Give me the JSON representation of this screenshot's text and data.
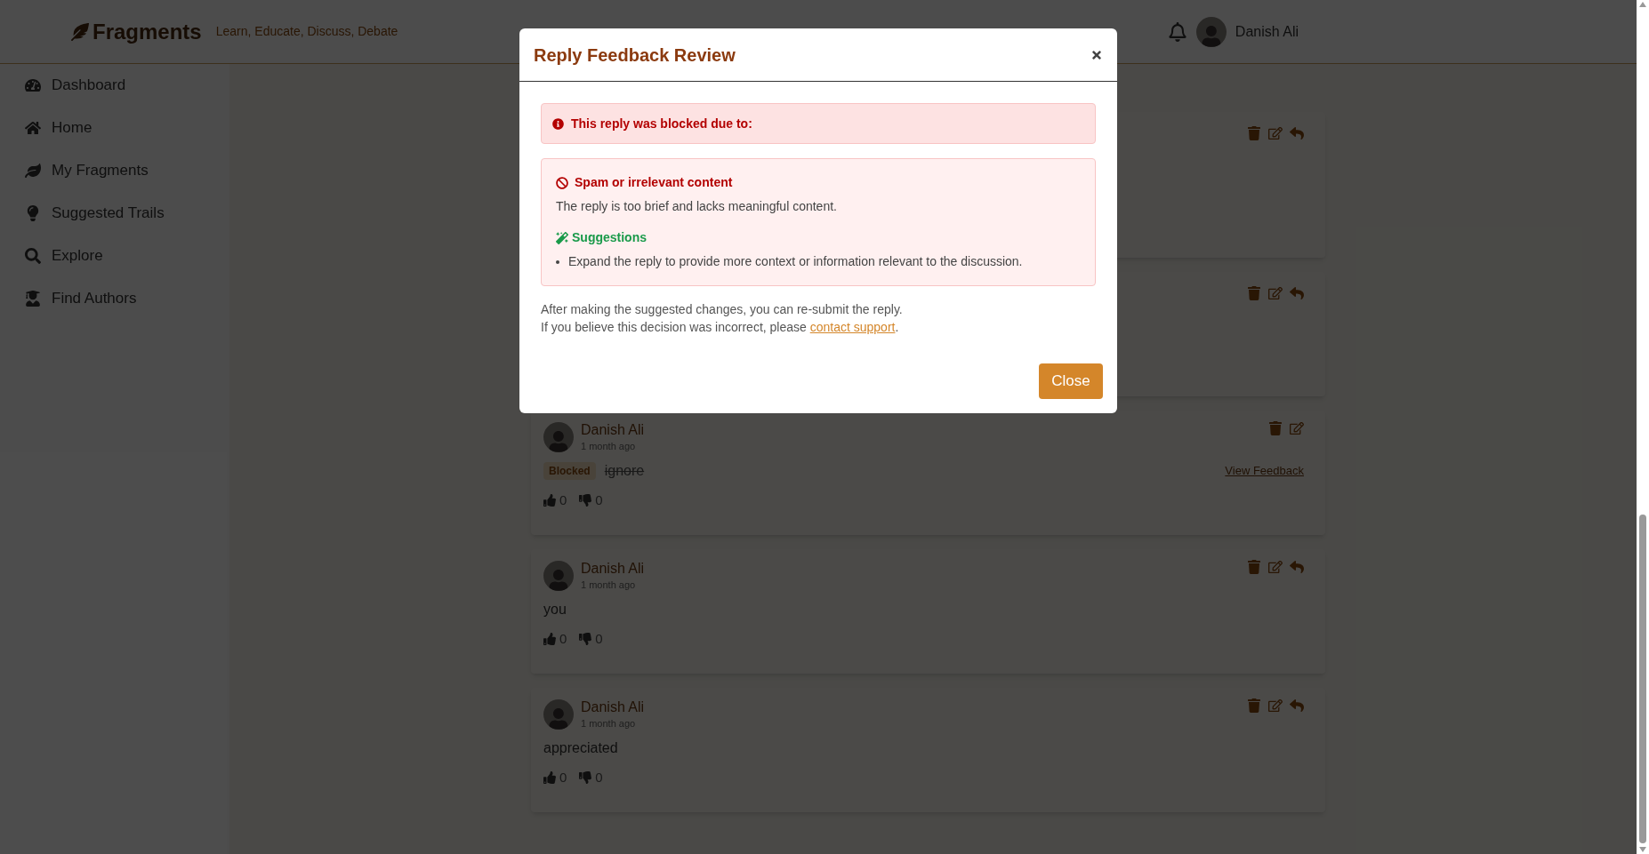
{
  "header": {
    "logo": "Fragments",
    "tagline": "Learn, Educate, Discuss, Debate",
    "user_name": "Danish Ali"
  },
  "sidebar": {
    "items": [
      {
        "label": "Dashboard"
      },
      {
        "label": "Home"
      },
      {
        "label": "My Fragments"
      },
      {
        "label": "Suggested Trails"
      },
      {
        "label": "Explore"
      },
      {
        "label": "Find Authors"
      }
    ]
  },
  "comments": [
    {
      "kind": "covered",
      "actions": [
        {
          "kind": "delete"
        },
        {
          "kind": "edit"
        },
        {
          "kind": "reply"
        }
      ]
    },
    {
      "kind": "covered",
      "actions": [
        {
          "kind": "delete"
        },
        {
          "kind": "edit"
        },
        {
          "kind": "reply"
        }
      ]
    },
    {
      "kind": "reply",
      "author": "Danish Ali",
      "time": "1 month ago",
      "badge": "Blocked",
      "text": "ignore",
      "struck": true,
      "feedback_link": "View Feedback",
      "likes": "0",
      "dislikes": "0",
      "actions": [
        {
          "kind": "delete"
        },
        {
          "kind": "edit"
        }
      ]
    },
    {
      "kind": "reply",
      "author": "Danish Ali",
      "time": "1 month ago",
      "text": "you",
      "struck": false,
      "likes": "0",
      "dislikes": "0",
      "actions": [
        {
          "kind": "delete"
        },
        {
          "kind": "edit"
        },
        {
          "kind": "reply"
        }
      ]
    },
    {
      "kind": "reply",
      "author": "Danish Ali",
      "time": "1 month ago",
      "text": "appreciated",
      "struck": false,
      "likes": "0",
      "dislikes": "0",
      "actions": [
        {
          "kind": "delete"
        },
        {
          "kind": "edit"
        },
        {
          "kind": "reply"
        }
      ]
    }
  ],
  "modal": {
    "title": "Reply Feedback Review",
    "alert": "This reply was blocked due to:",
    "reason": {
      "title": "Spam or irrelevant content",
      "description": "The reply is too brief and lacks meaningful content.",
      "suggestions_title": "Suggestions",
      "suggestions": [
        "Expand the reply to provide more context or information relevant to the discussion."
      ]
    },
    "note": "After making the suggested changes, you can re-submit the reply.",
    "support": {
      "before": "If you believe this decision was incorrect, please ",
      "link": "contact support",
      "after": "."
    },
    "button": "Close"
  }
}
